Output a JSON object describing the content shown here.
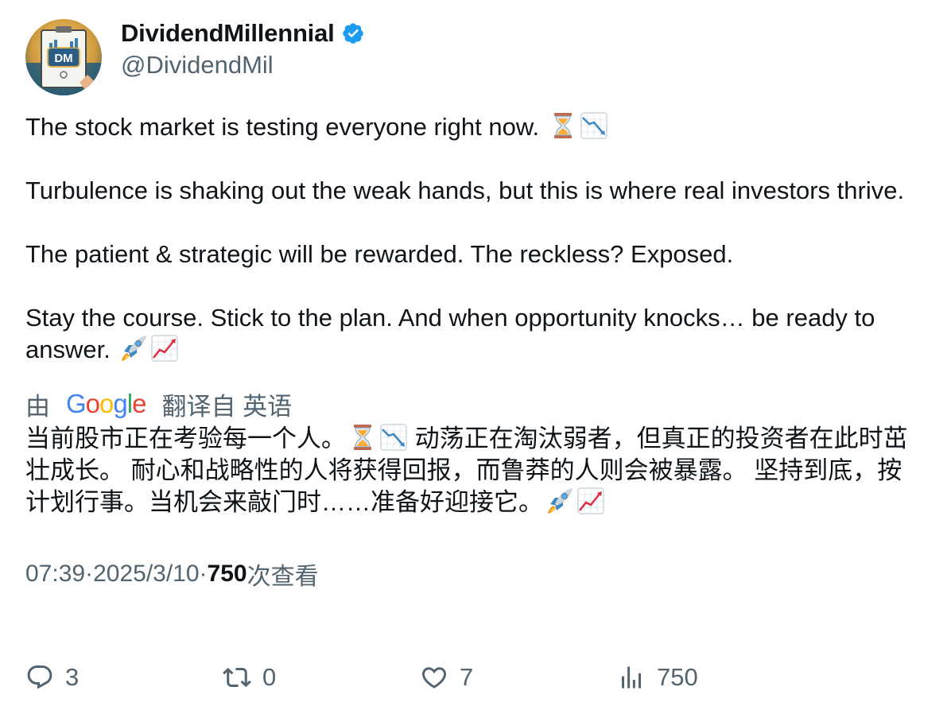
{
  "author": {
    "display_name": "DividendMillennial",
    "handle": "@DividendMil",
    "avatar_text": "DM",
    "verified_icon": "verified-badge-icon"
  },
  "tweet": {
    "line1": "The stock market is testing everyone right now.",
    "line2": "Turbulence is shaking out the weak hands, but this is where real investors thrive.",
    "line3": "The patient & strategic will be rewarded. The reckless? Exposed.",
    "line4": "Stay the course. Stick to the plan. And when opportunity knocks… be ready to answer.",
    "emojis_line1": [
      "hourglass-icon",
      "chart-decreasing-icon"
    ],
    "emojis_line4": [
      "rocket-icon",
      "chart-increasing-icon"
    ]
  },
  "translation": {
    "prefix": "由",
    "google": "Google",
    "suffix": "翻译自",
    "source_lang": "英语",
    "part1": "当前股市正在考验每一个人。",
    "part2": " 动荡正在淘汰弱者，但真正的投资者在此时茁壮成长。 耐心和战略性的人将获得回报，而鲁莽的人则会被暴露。 坚持到底，按计划行事。当机会来敲门时……准备好迎接它。"
  },
  "meta": {
    "time": "07:39",
    "sep": " · ",
    "date": "2025/3/10",
    "views_num": "750",
    "views_label": "次查看"
  },
  "actions": {
    "replies": "3",
    "retweets": "0",
    "likes": "7",
    "views": "750"
  },
  "colors": {
    "text": "#0f1419",
    "secondary": "#536471",
    "verified": "#1d9bf0"
  }
}
